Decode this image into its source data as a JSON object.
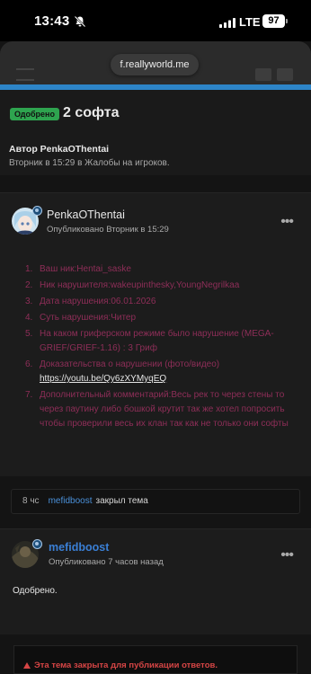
{
  "status_bar": {
    "time": "13:43",
    "network": "LTE",
    "battery": "97"
  },
  "browser": {
    "url": "f.reallyworld.me"
  },
  "thread": {
    "badge": "Одобрено",
    "title": "2 софта",
    "author_label": "Автор PenkaOThentai",
    "meta": "Вторник в 15:29 в Жалобы на игроков."
  },
  "post1": {
    "username": "PenkaOThentai",
    "published": "Опубликовано Вторник в 15:29",
    "items": [
      {
        "num": "1.",
        "text": "Ваш ник:Hentai_saske"
      },
      {
        "num": "2.",
        "text": "Ник нарушителя:wakeupinthesky,YoungNegrilkaa"
      },
      {
        "num": "3.",
        "text": "Дата нарушения:06.01.2026"
      },
      {
        "num": "4.",
        "text": "Суть нарушения:Читер"
      },
      {
        "num": "5.",
        "text": "На каком гриферском режиме было нарушение (MEGA-GRIEF/GRIEF-1.16) : 3 Гриф"
      },
      {
        "num": "6.",
        "text": "Доказательства о нарушении (фото/видео)",
        "link": "https://youtu.be/Qy6zXYMyqEQ"
      },
      {
        "num": "7.",
        "text": "Дополнительный комментарий:Весь рек то через стены то через паутину либо бошкой крутит так же хотел попросить чтобы проверили весь их клан так как не только они софты"
      }
    ]
  },
  "system_message": {
    "time": "8 чс",
    "user": "mefidboost",
    "action": "закрыл тема"
  },
  "post2": {
    "username": "mefidboost",
    "published": "Опубликовано 7 часов назад",
    "body": "Одобрено."
  },
  "closed_notice": "Эта тема закрыта для публикации ответов."
}
